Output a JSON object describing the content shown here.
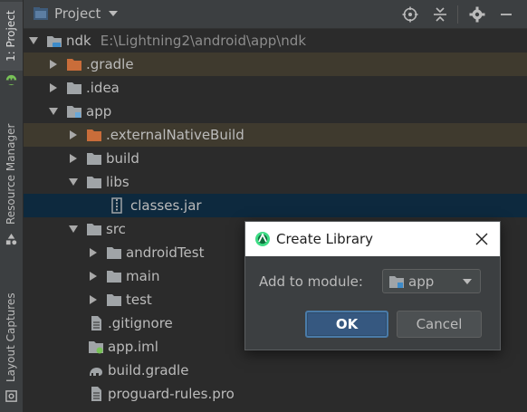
{
  "tool_strip": {
    "project_tab": "1: Project",
    "resource_tab": "Resource Manager",
    "layout_tab": "Layout Captures"
  },
  "header": {
    "title": "Project",
    "icons": [
      "target-icon",
      "collapse-icon",
      "gear-icon",
      "minimize-icon"
    ]
  },
  "tree": {
    "root": {
      "label": "ndk",
      "path": "E:\\Lightning2\\android\\app\\ndk"
    },
    "gradle_folder": ".gradle",
    "idea_folder": ".idea",
    "app_module": "app",
    "external_native_build": ".externalNativeBuild",
    "build_folder": "build",
    "libs_folder": "libs",
    "classes_jar": "classes.jar",
    "src_folder": "src",
    "android_test": "androidTest",
    "main_folder": "main",
    "test_folder": "test",
    "gitignore": ".gitignore",
    "app_iml": "app.iml",
    "build_gradle": "build.gradle",
    "proguard": "proguard-rules.pro"
  },
  "dialog": {
    "title": "Create Library",
    "module_label": "Add to module:",
    "module_value": "app",
    "ok_label": "OK",
    "cancel_label": "Cancel"
  },
  "colors": {
    "background": "#2b2b2b",
    "panel": "#3c3f41",
    "selection": "#0d293e",
    "excluded": "#3f3a2e",
    "folder": "#a0a4a7",
    "excluded_folder": "#c96d3a",
    "primary_button": "#365880",
    "android_green": "#78c257"
  }
}
